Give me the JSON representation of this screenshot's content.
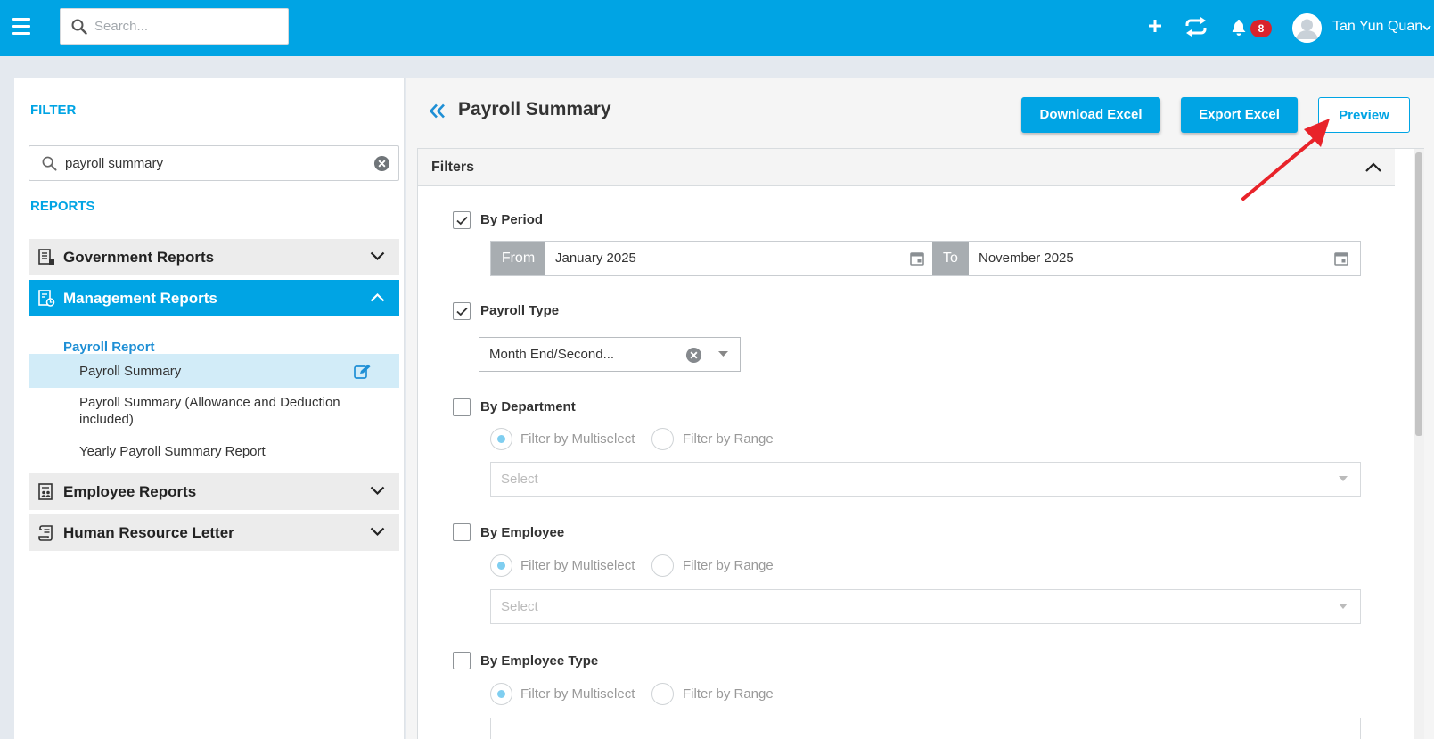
{
  "topbar": {
    "search_placeholder": "Search...",
    "notification_count": "8",
    "user_name": "Tan Yun Quan"
  },
  "sidebar": {
    "filter_heading": "FILTER",
    "filter_value": "payroll summary",
    "reports_heading": "REPORTS",
    "categories": [
      {
        "label": "Government Reports",
        "expanded": false
      },
      {
        "label": "Management Reports",
        "expanded": true
      },
      {
        "label": "Employee Reports",
        "expanded": false
      },
      {
        "label": "Human Resource Letter",
        "expanded": false
      }
    ],
    "subcategory": "Payroll Report",
    "reports": [
      {
        "label": "Payroll Summary",
        "selected": true
      },
      {
        "label": "Payroll Summary (Allowance and Deduction included)",
        "selected": false
      },
      {
        "label": "Yearly Payroll Summary Report",
        "selected": false
      }
    ]
  },
  "main": {
    "title": "Payroll Summary",
    "buttons": {
      "download_excel": "Download Excel",
      "export_excel": "Export Excel",
      "preview": "Preview"
    },
    "filters": {
      "heading": "Filters",
      "by_period": {
        "label": "By Period",
        "checked": true,
        "from_label": "From",
        "from_value": "January 2025",
        "to_label": "To",
        "to_value": "November 2025"
      },
      "payroll_type": {
        "label": "Payroll Type",
        "checked": true,
        "value": "Month End/Second..."
      },
      "radio_multiselect": "Filter by Multiselect",
      "radio_range": "Filter by Range",
      "select_placeholder": "Select",
      "by_department": {
        "label": "By Department",
        "checked": false
      },
      "by_employee": {
        "label": "By Employee",
        "checked": false
      },
      "by_employee_type": {
        "label": "By Employee Type",
        "checked": false
      }
    }
  },
  "colors": {
    "brand": "#00a4e4",
    "badge": "#d9232c",
    "annotation_arrow": "#e8232a"
  }
}
